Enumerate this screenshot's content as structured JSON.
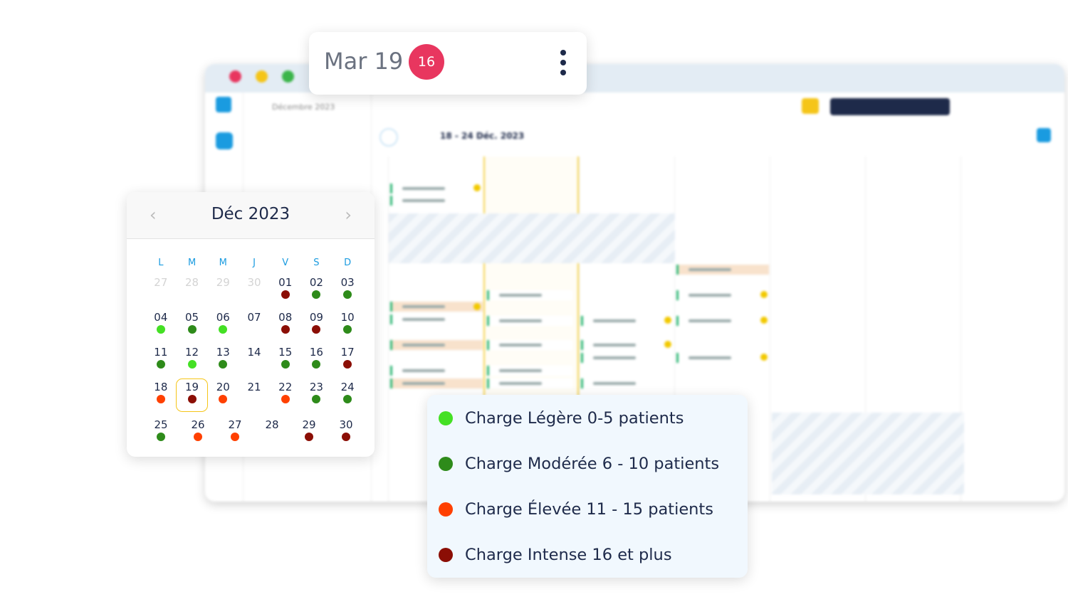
{
  "background_app": {
    "mini_calendar_title": "Décembre 2023",
    "week_range": "18 - 24 Déc. 2023"
  },
  "day_tooltip": {
    "label": "Mar 19",
    "count": "16"
  },
  "calendar": {
    "title": "Déc 2023",
    "weekdays": [
      "L",
      "M",
      "M",
      "J",
      "V",
      "S",
      "D"
    ],
    "weeks": [
      [
        {
          "d": "27",
          "muted": true
        },
        {
          "d": "28",
          "muted": true
        },
        {
          "d": "29",
          "muted": true
        },
        {
          "d": "30",
          "muted": true
        },
        {
          "d": "01",
          "load": "intense"
        },
        {
          "d": "02",
          "load": "moderate"
        },
        {
          "d": "03",
          "load": "moderate"
        }
      ],
      [
        {
          "d": "04",
          "load": "light"
        },
        {
          "d": "05",
          "load": "moderate"
        },
        {
          "d": "06",
          "load": "light"
        },
        {
          "d": "07"
        },
        {
          "d": "08",
          "load": "intense"
        },
        {
          "d": "09",
          "load": "intense"
        },
        {
          "d": "10",
          "load": "moderate"
        }
      ],
      [
        {
          "d": "11",
          "load": "moderate"
        },
        {
          "d": "12",
          "load": "light"
        },
        {
          "d": "13",
          "load": "moderate"
        },
        {
          "d": "14"
        },
        {
          "d": "15",
          "load": "moderate"
        },
        {
          "d": "16",
          "load": "moderate"
        },
        {
          "d": "17",
          "load": "intense"
        }
      ],
      [
        {
          "d": "18",
          "load": "high"
        },
        {
          "d": "19",
          "load": "intense",
          "selected": true
        },
        {
          "d": "20",
          "load": "high"
        },
        {
          "d": "21"
        },
        {
          "d": "22",
          "load": "high"
        },
        {
          "d": "23",
          "load": "moderate"
        },
        {
          "d": "24",
          "load": "moderate"
        }
      ]
    ],
    "last_week": [
      {
        "d": "25",
        "load": "moderate"
      },
      {
        "d": "26",
        "load": "high"
      },
      {
        "d": "27",
        "load": "high"
      },
      {
        "d": "28"
      },
      {
        "d": "29",
        "load": "intense"
      },
      {
        "d": "30",
        "load": "intense"
      }
    ]
  },
  "legend": [
    {
      "key": "light",
      "label": "Charge Légère 0-5 patients",
      "color": "#44e024"
    },
    {
      "key": "moderate",
      "label": "Charge Modérée 6 - 10 patients",
      "color": "#2e8b1a"
    },
    {
      "key": "high",
      "label": "Charge Élevée 11 - 15 patients",
      "color": "#ff4000"
    },
    {
      "key": "intense",
      "label": "Charge Intense 16 et plus",
      "color": "#8b0e05"
    }
  ],
  "colors": {
    "badge": "#e8365f",
    "weekday": "#1a9be0",
    "selected_outline": "#f5c518"
  }
}
